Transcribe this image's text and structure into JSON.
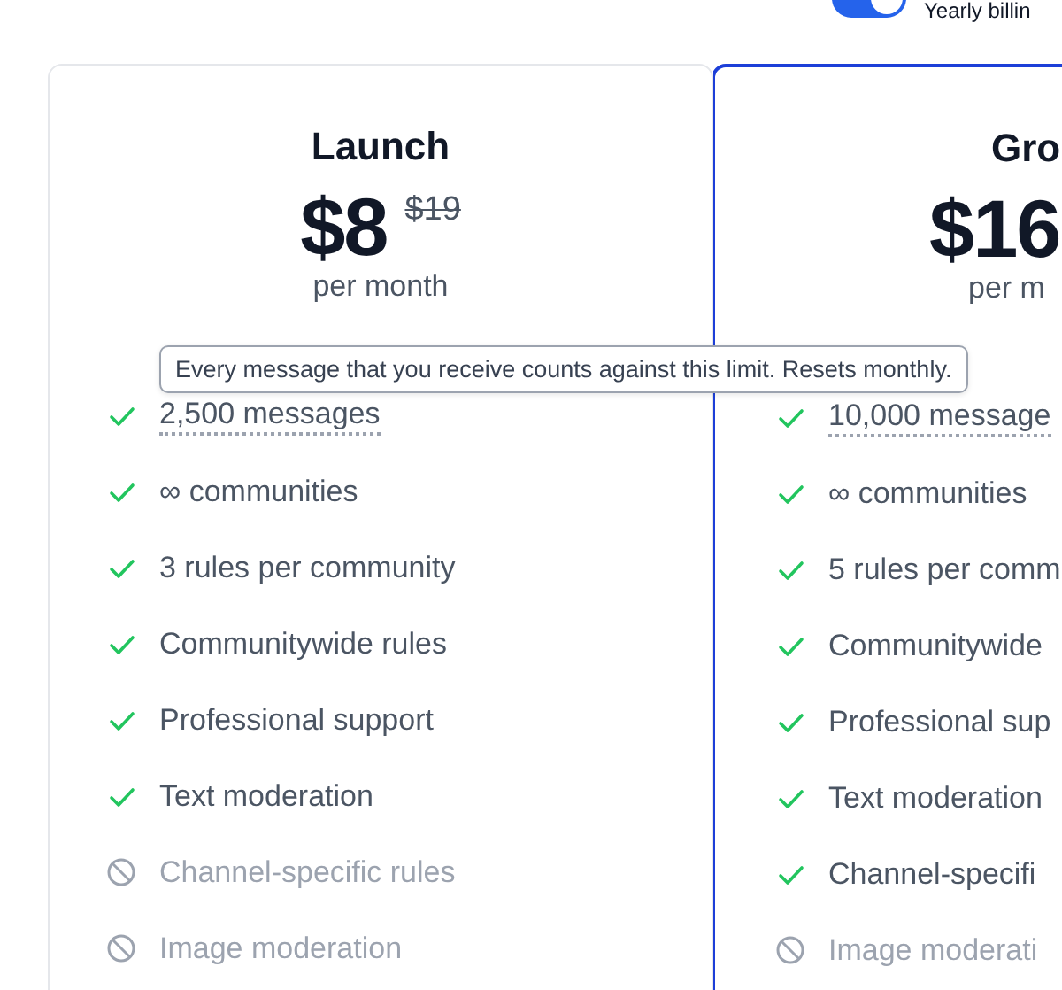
{
  "billing_toggle": {
    "label": "Yearly billin",
    "on": true
  },
  "plans": [
    {
      "name": "Launch",
      "selected": false,
      "price": "$8",
      "old_price": "$19",
      "period": "per month",
      "features": [
        {
          "text": "2,500 messages",
          "included": true,
          "hint": true
        },
        {
          "text": "∞ communities",
          "included": true,
          "hint": false
        },
        {
          "text": "3 rules per community",
          "included": true,
          "hint": false
        },
        {
          "text": "Communitywide rules",
          "included": true,
          "hint": false
        },
        {
          "text": "Professional support",
          "included": true,
          "hint": false
        },
        {
          "text": "Text moderation",
          "included": true,
          "hint": false
        },
        {
          "text": "Channel-specific rules",
          "included": false,
          "hint": false
        },
        {
          "text": "Image moderation",
          "included": false,
          "hint": false
        }
      ]
    },
    {
      "name": "Gro",
      "selected": true,
      "price": "$16",
      "period": "per m",
      "features": [
        {
          "text": "10,000 message",
          "included": true,
          "hint": true
        },
        {
          "text": "∞ communities",
          "included": true,
          "hint": false
        },
        {
          "text": "5 rules per comm",
          "included": true,
          "hint": false
        },
        {
          "text": "Communitywide",
          "included": true,
          "hint": false
        },
        {
          "text": "Professional sup",
          "included": true,
          "hint": false
        },
        {
          "text": "Text moderation",
          "included": true,
          "hint": false
        },
        {
          "text": "Channel-specifi",
          "included": true,
          "hint": false
        },
        {
          "text": "Image moderati",
          "included": false,
          "hint": false
        }
      ]
    }
  ],
  "tooltip": {
    "text": "Every message that you receive counts against this limit. Resets monthly."
  }
}
